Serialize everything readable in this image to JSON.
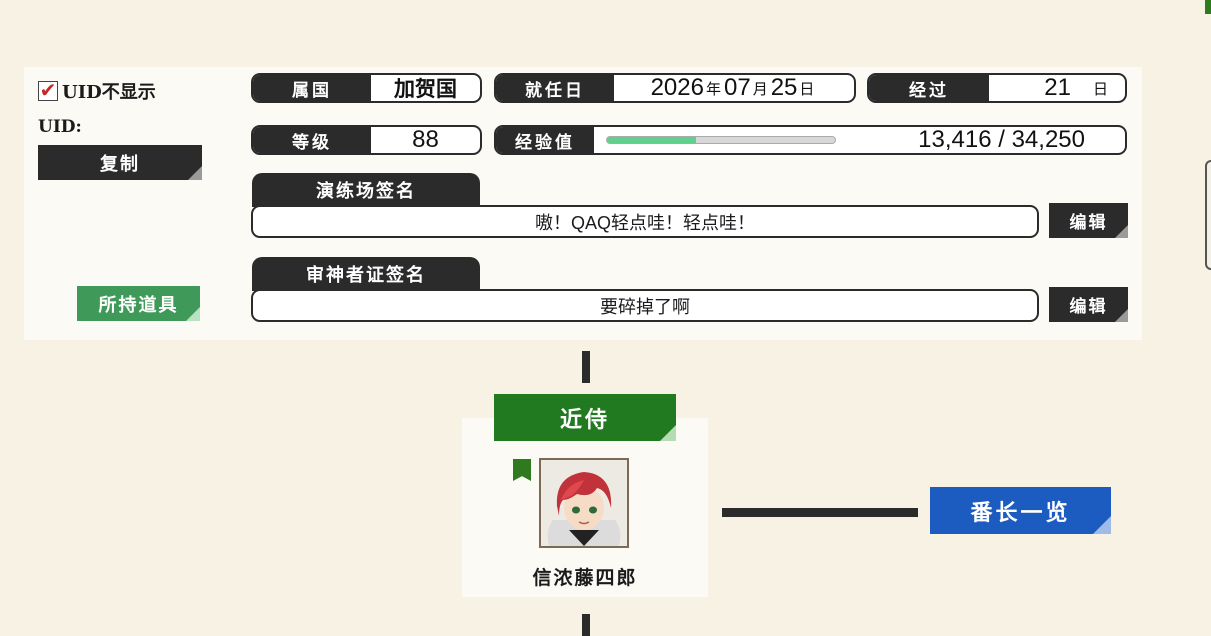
{
  "profile": {
    "hide_uid_label": "UID不显示",
    "hide_uid_checked": true,
    "uid_label": "UID:",
    "uid_value": "",
    "copy_button": "复制",
    "items_button": "所持道具"
  },
  "info": {
    "country_label": "属国",
    "country_value": "加贺国",
    "inauguration_label": "就任日",
    "inauguration_year": "2026",
    "inauguration_year_unit": "年",
    "inauguration_month": "07",
    "inauguration_month_unit": "月",
    "inauguration_day": "25",
    "inauguration_day_unit": "日",
    "elapsed_label": "经过",
    "elapsed_value": "21",
    "elapsed_unit": "日",
    "level_label": "等级",
    "level_value": "88",
    "exp_label": "经验值",
    "exp_text": "13,416 / 34,250",
    "exp_current": 13416,
    "exp_total": 34250,
    "exp_bar_color": "#5fd08d"
  },
  "signatures": {
    "practice_title": "演练场签名",
    "practice_text": "嗷！QAQ轻点哇！轻点哇！",
    "examiner_title": "审神者证签名",
    "examiner_text": "要碎掉了啊",
    "edit_label": "编辑"
  },
  "attendant": {
    "header": "近侍",
    "name": "信浓藤四郎",
    "badge_text": "",
    "header_color": "#217a1f"
  },
  "leader_button": {
    "label": "番长一览",
    "color": "#1c5bbf"
  }
}
